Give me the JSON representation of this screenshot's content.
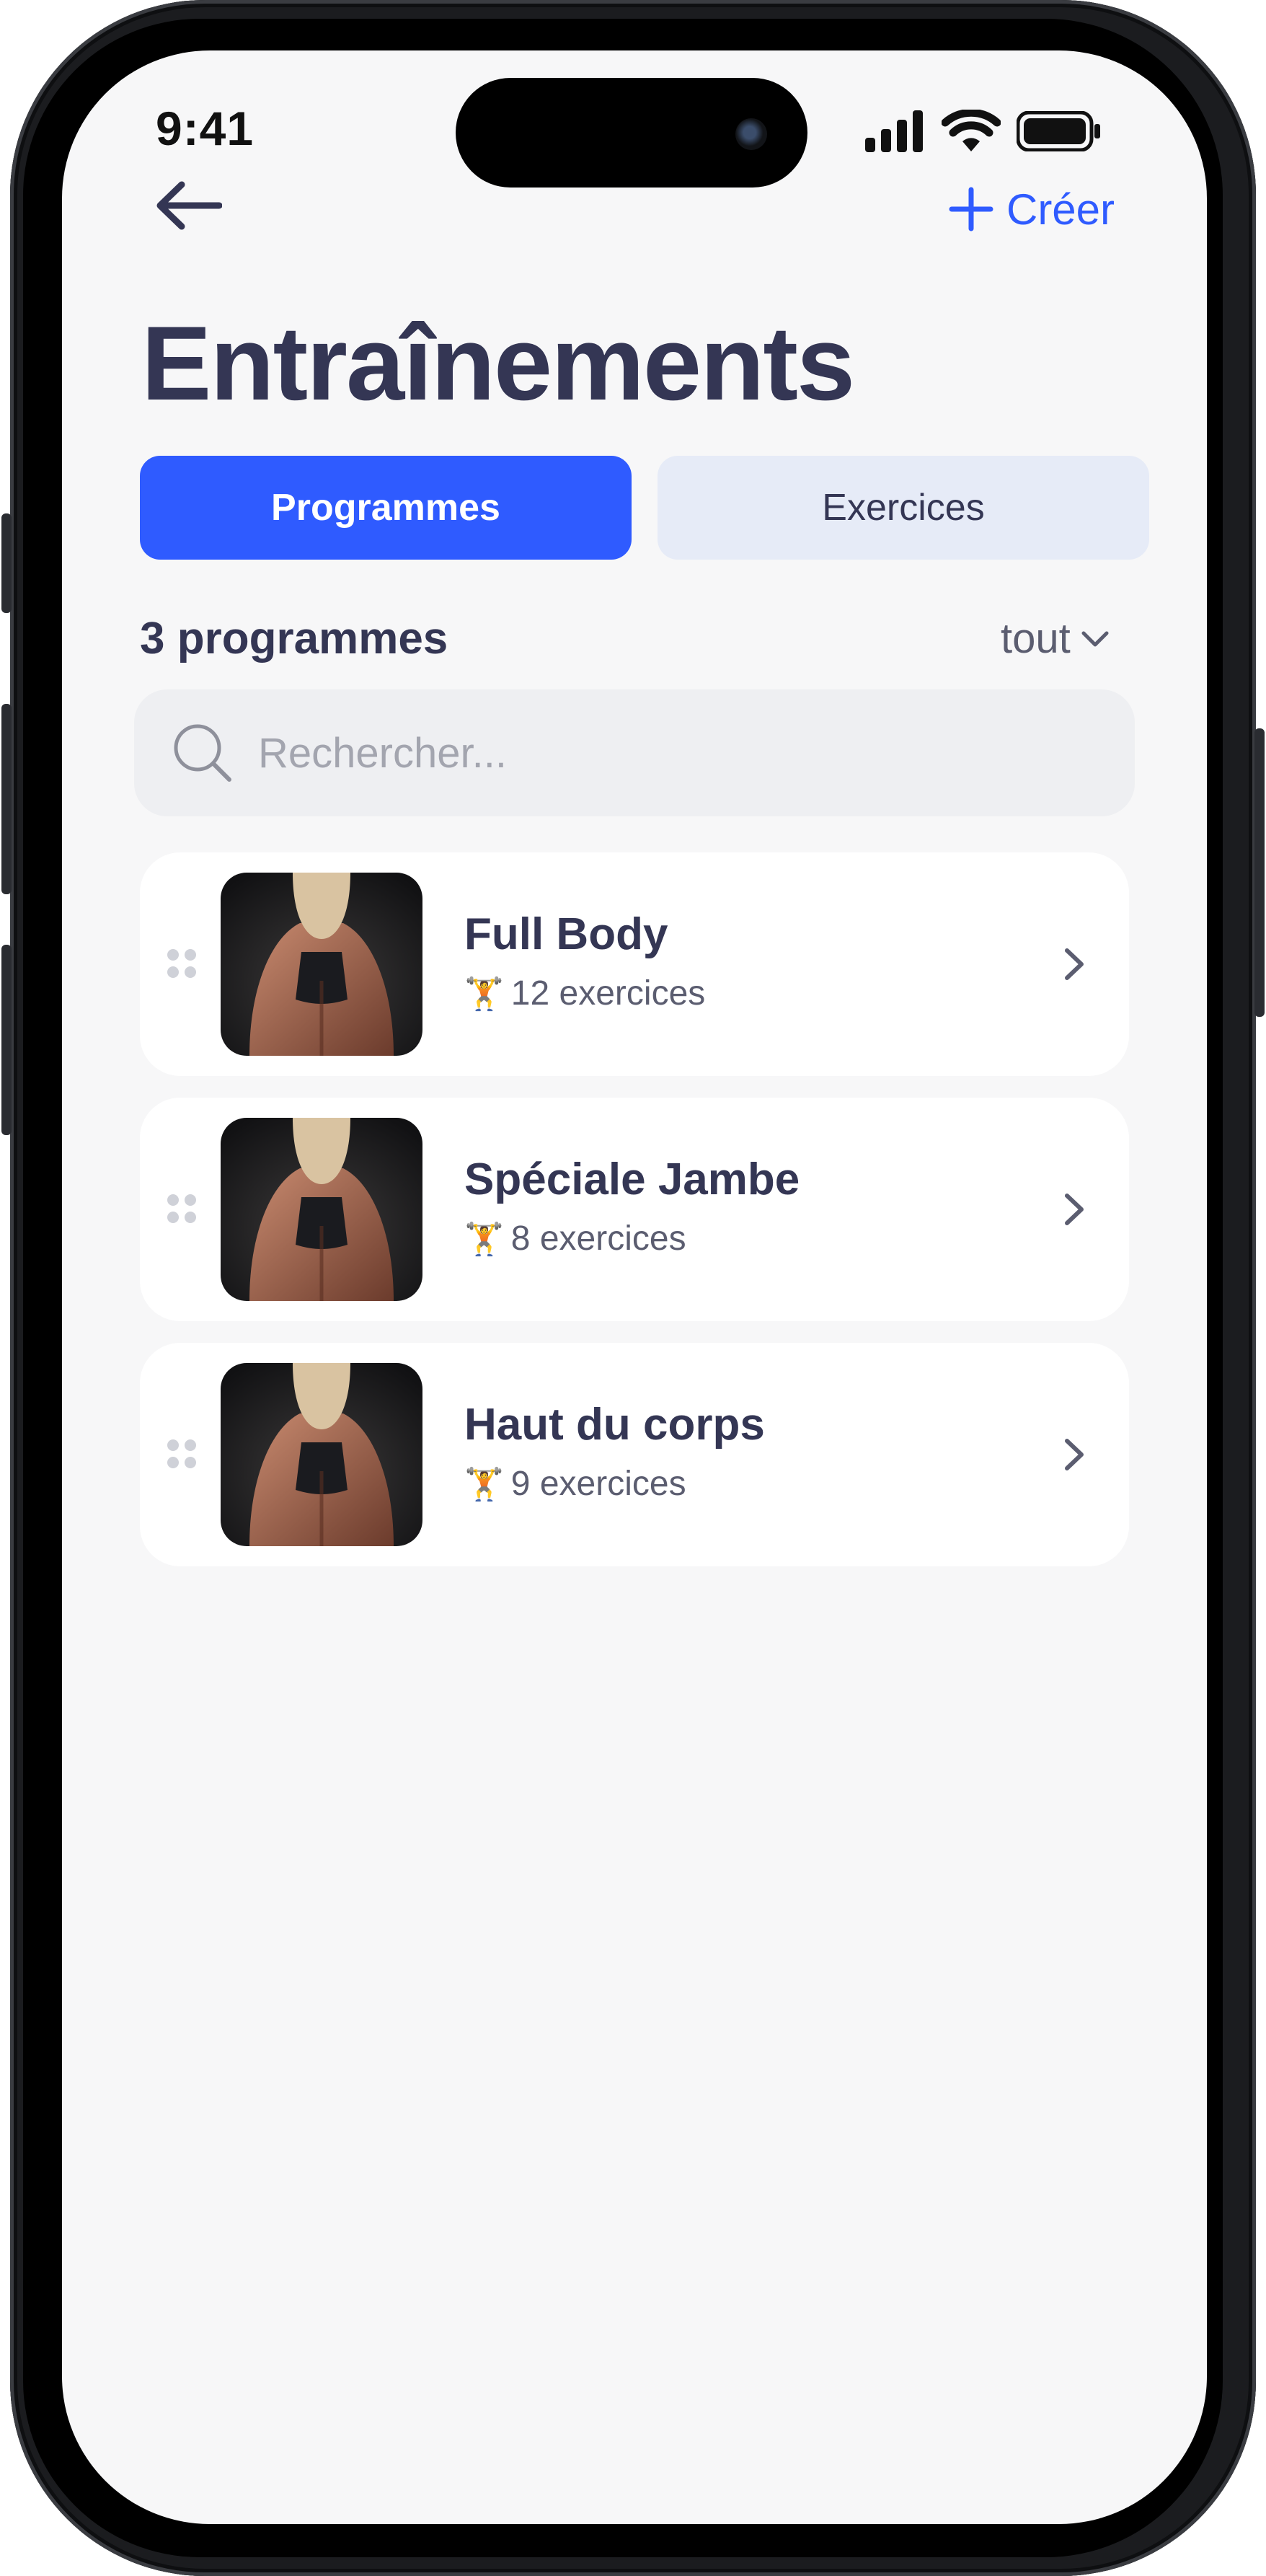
{
  "status": {
    "time": "9:41"
  },
  "header": {
    "create_label": "Créer"
  },
  "page": {
    "title": "Entraînements"
  },
  "tabs": [
    {
      "label": "Programmes",
      "active": true
    },
    {
      "label": "Exercices",
      "active": false
    }
  ],
  "list": {
    "count_label": "3 programmes",
    "filter_label": "tout"
  },
  "search": {
    "placeholder": "Rechercher..."
  },
  "programs": [
    {
      "title": "Full Body",
      "emoji": "🏋️",
      "exercises": "12 exercices"
    },
    {
      "title": "Spéciale Jambe",
      "emoji": "🏋️",
      "exercises": "8 exercices"
    },
    {
      "title": "Haut du corps",
      "emoji": "🏋️",
      "exercises": "9 exercices"
    }
  ],
  "colors": {
    "accent": "#2f5bff",
    "title": "#343654",
    "tab_inactive": "#e6ebf7",
    "background": "#f7f7f8"
  },
  "icons": [
    "back-arrow-icon",
    "plus-icon",
    "chevron-down-icon",
    "search-icon",
    "drag-handle-icon",
    "chevron-right-icon",
    "weightlifter-icon"
  ]
}
